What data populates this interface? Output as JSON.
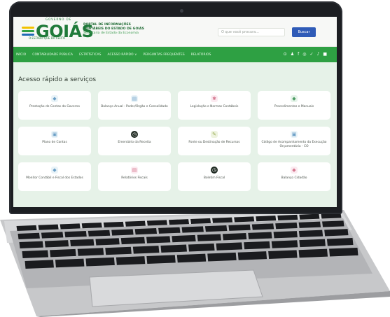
{
  "header": {
    "logo_text": "GOIÁS",
    "logo_pre": "GOVERNO DE",
    "logo_sub": "O ESTADO QUE DÁ CERTO",
    "portal_title_1": "PORTAL DE INFORMAÇÕES",
    "portal_title_2": "CONTÁBEIS DO ESTADO DE GOIÁS",
    "portal_title_3": "Secretaria de Estado da Economia",
    "search_placeholder": "O que você procura...",
    "search_button": "Buscar"
  },
  "nav": {
    "items": [
      "INÍCIO",
      "CONTABILIDADE PÚBLICA",
      "ESTÁTÍSTICAS",
      "ACESSO RÁPIDO ∨",
      "PERGUNTAS FREQUENTES",
      "RELATÓRIOS"
    ],
    "icons": [
      "⊙",
      "♟",
      "f",
      "◎",
      "✓",
      "♪",
      "■"
    ]
  },
  "main": {
    "section_title": "Acesso rápido a serviços",
    "cards": [
      {
        "label": "Prestação de Contas do Governo",
        "icon": "megaphone-icon",
        "glyph": "◆",
        "style": "soft"
      },
      {
        "label": "Balanço Anual - Poder/Órgão e Consolidado",
        "icon": "document-icon",
        "glyph": "▤",
        "style": "soft"
      },
      {
        "label": "Legislação e Normas Contábeis",
        "icon": "gear-icon",
        "glyph": "✱",
        "style": "pink"
      },
      {
        "label": "Procedimentos e Manuais",
        "icon": "flag-icon",
        "glyph": "◆",
        "style": "green"
      },
      {
        "label": "Plano de Contas",
        "icon": "folder-icon",
        "glyph": "▣",
        "style": "soft"
      },
      {
        "label": "Ementário da Receita",
        "icon": "clock-icon",
        "glyph": "◷",
        "style": "dark"
      },
      {
        "label": "Fonte ou Destinação de Recursos",
        "icon": "link-icon",
        "glyph": "✎",
        "style": "olive"
      },
      {
        "label": "Código de Acompanhamento da Execução Orçamentária - CO",
        "icon": "box-icon",
        "glyph": "▣",
        "style": "soft"
      },
      {
        "label": "Monitor Contábil e Fiscal dos Estados",
        "icon": "chart-icon",
        "glyph": "◆",
        "style": "soft"
      },
      {
        "label": "Relatórios Fiscais",
        "icon": "report-icon",
        "glyph": "▤",
        "style": "pink"
      },
      {
        "label": "Boletim Fiscal",
        "icon": "clock-icon",
        "glyph": "◷",
        "style": "dark"
      },
      {
        "label": "Balanço Cidadão",
        "icon": "people-icon",
        "glyph": "◆",
        "style": "pink"
      }
    ]
  },
  "colors": {
    "nav_green": "#2ea043",
    "content_bg": "#e6f2e8",
    "button_blue": "#2f5bb7"
  }
}
